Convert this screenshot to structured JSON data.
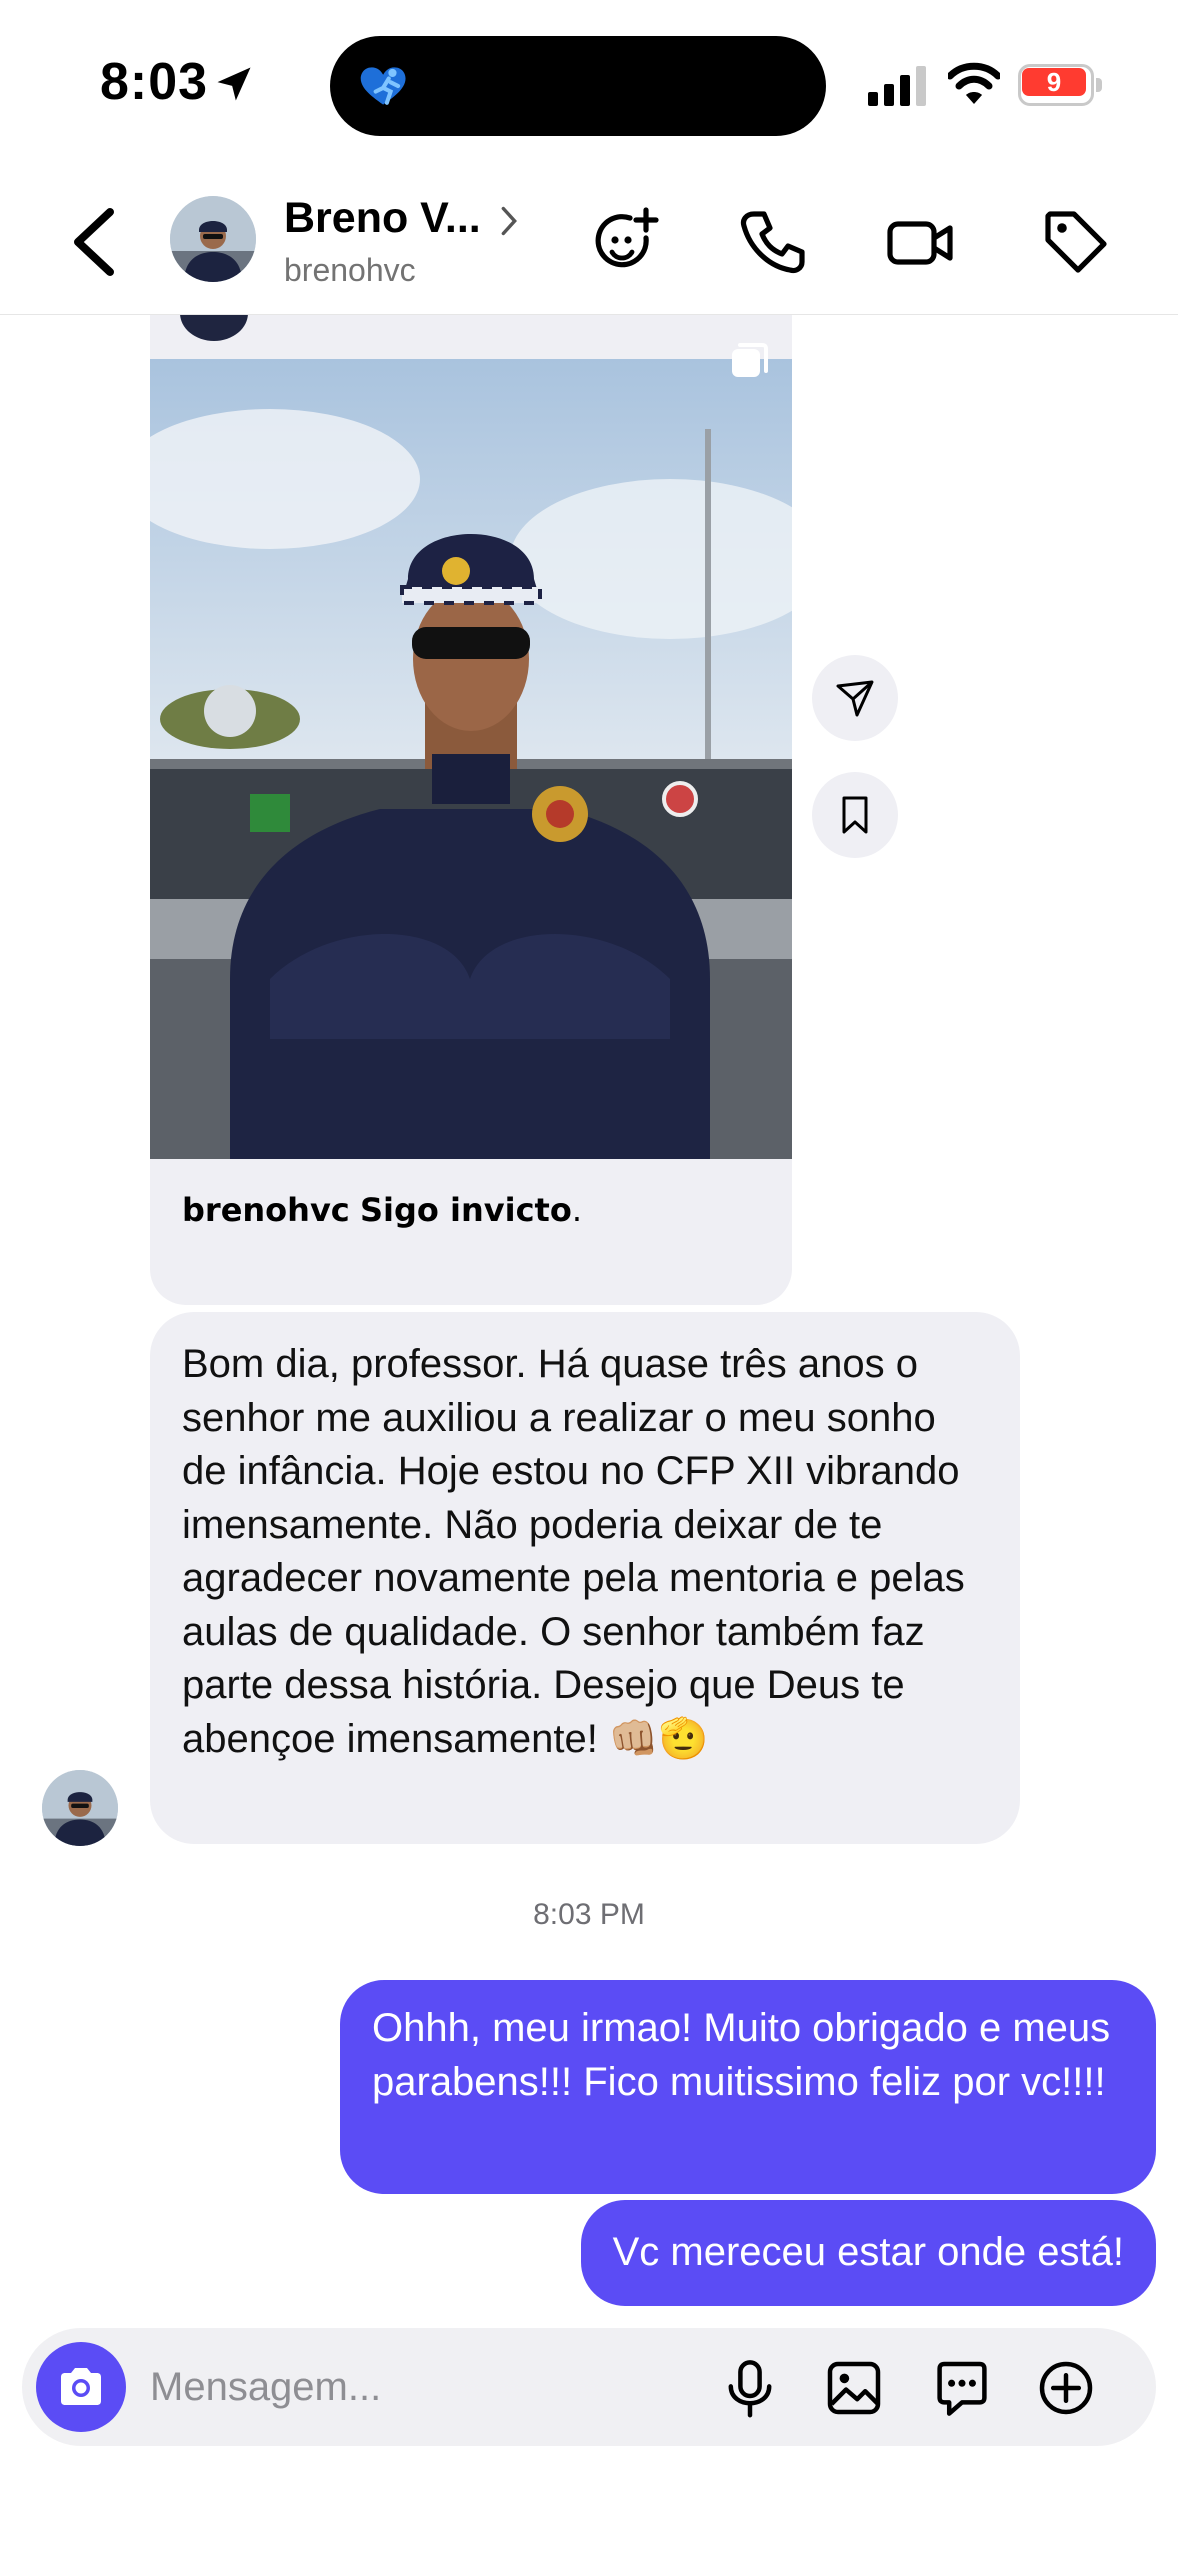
{
  "status_bar": {
    "time": "8:03",
    "battery": "9",
    "icons": [
      "location-arrow-icon",
      "fitness-activity-icon",
      "cellular-signal-icon",
      "wifi-icon",
      "battery-low-icon"
    ]
  },
  "header": {
    "name": "Breno V...",
    "username": "brenohvc",
    "icons": [
      "back-chevron-icon",
      "chevron-right-icon",
      "sticker-add-icon",
      "phone-icon",
      "video-camera-icon",
      "tag-icon"
    ]
  },
  "shared_post": {
    "caption_user": "brenohvc",
    "caption_text": "Sigo invicto",
    "caption_end": ".",
    "icons": [
      "multiple-media-icon"
    ]
  },
  "side_actions": {
    "icons": [
      "share-send-icon",
      "bookmark-icon"
    ]
  },
  "messages": {
    "incoming": "Bom dia, professor. Há quase três anos o senhor me auxiliou a realizar o meu sonho de infância. Hoje estou no CFP XII vibrando imensamente. Não poderia deixar de te agradecer novamente pela mentoria e pelas aulas de qualidade. O senhor também faz parte dessa história. Desejo que Deus te abençoe imensamente! 👊🏼🫡",
    "timestamp": "8:03 PM",
    "outgoing_1": "Ohhh, meu irmao! Muito obrigado e meus parabens!!! Fico muitissimo feliz por vc!!!!",
    "outgoing_2": "Vc mereceu estar onde está!"
  },
  "composer": {
    "placeholder": "Mensagem...",
    "icons": [
      "camera-icon",
      "microphone-icon",
      "gallery-icon",
      "chat-options-icon",
      "add-circle-icon"
    ]
  },
  "colors": {
    "accent": "#5b4cf5",
    "bubble_gray": "#efeff4",
    "battery_red": "#ff3b30"
  }
}
